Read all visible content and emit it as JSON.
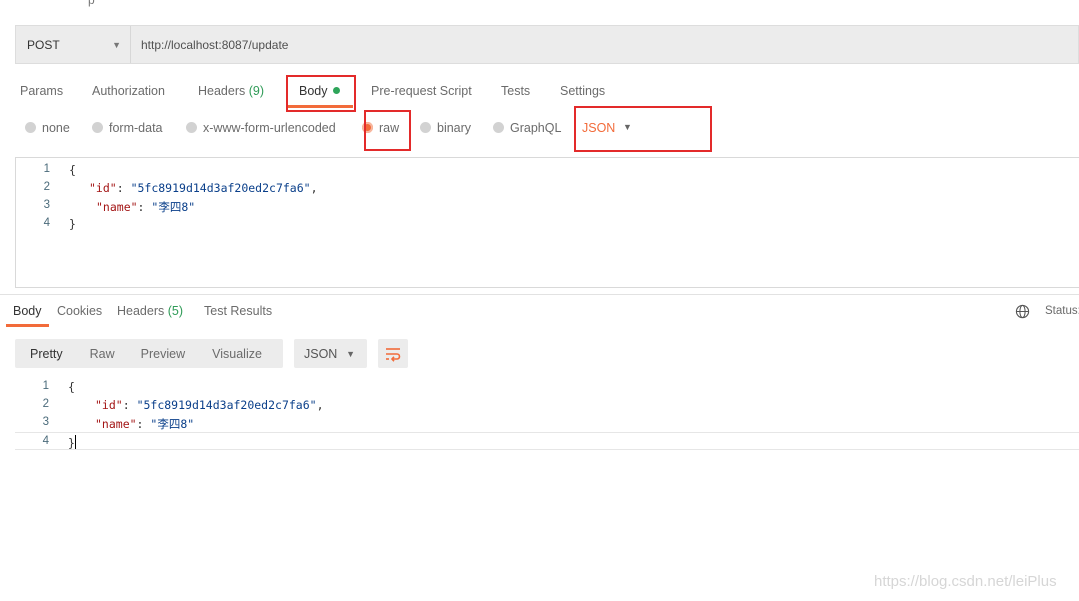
{
  "request": {
    "method": "POST",
    "url": "http://localhost:8087/update"
  },
  "request_tabs": [
    {
      "label": "Params"
    },
    {
      "label": "Authorization"
    },
    {
      "label": "Headers",
      "count": "(9)"
    },
    {
      "label": "Body"
    },
    {
      "label": "Pre-request Script"
    },
    {
      "label": "Tests"
    },
    {
      "label": "Settings"
    }
  ],
  "body_types": [
    "none",
    "form-data",
    "x-www-form-urlencoded",
    "raw",
    "binary",
    "GraphQL"
  ],
  "body_language": "JSON",
  "request_body": {
    "line_numbers": [
      "1",
      "2",
      "3",
      "4"
    ],
    "open_brace": "{",
    "close_brace": "}",
    "id_key": "\"id\"",
    "id_value": "\"5fc8919d14d3af20ed2c7fa6\"",
    "name_key": "\"name\"",
    "name_value": "\"李四8\""
  },
  "response_tabs": [
    {
      "label": "Body"
    },
    {
      "label": "Cookies"
    },
    {
      "label": "Headers",
      "count": "(5)"
    },
    {
      "label": "Test Results"
    }
  ],
  "status_label": "Status:",
  "view_modes": [
    "Pretty",
    "Raw",
    "Preview",
    "Visualize"
  ],
  "response_format": "JSON",
  "response_body": {
    "line_numbers": [
      "1",
      "2",
      "3",
      "4"
    ],
    "open_brace": "{",
    "close_brace": "}",
    "id_key": "\"id\"",
    "id_value": "\"5fc8919d14d3af20ed2c7fa6\"",
    "name_key": "\"name\"",
    "name_value": "\"李四8\""
  },
  "top_fragment": "p",
  "watermark": "https://blog.csdn.net/leiPlus",
  "colors": {
    "accent": "#f26b3a",
    "highlight_box": "#e32a2a",
    "count_green": "#2f9b57",
    "json_key": "#a31515",
    "json_string": "#0a3f8a"
  }
}
